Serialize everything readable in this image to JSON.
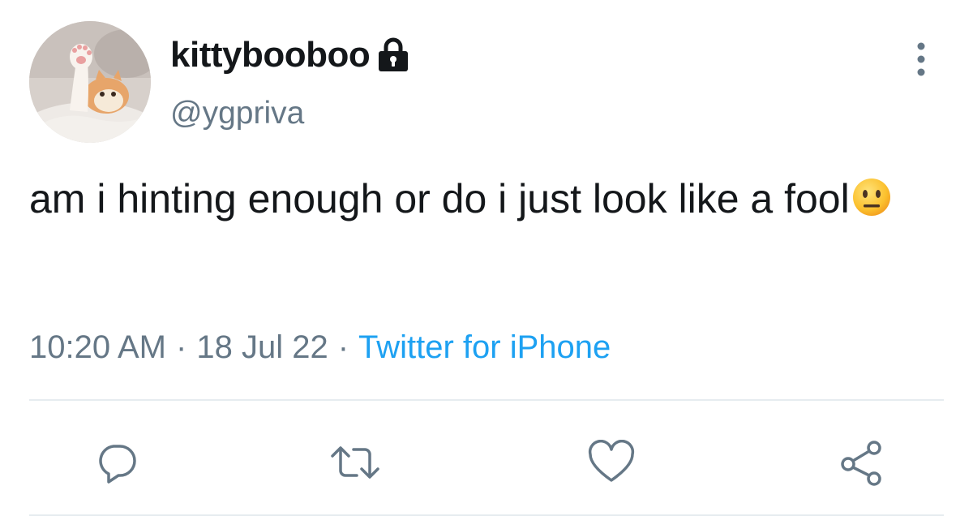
{
  "user": {
    "display_name": "kittybooboo",
    "handle": "@ygpriva",
    "protected_icon": "lock-icon",
    "avatar": "avatar-photo"
  },
  "tweet": {
    "text": "am i hinting enough or do i just look like a fool",
    "emoji": "neutral-face-emoji"
  },
  "meta": {
    "time": "10:20 AM",
    "separator": "·",
    "date": "18 Jul 22",
    "source": "Twitter for iPhone"
  },
  "menu": {
    "icon": "more-vertical-icon"
  },
  "actions": [
    {
      "icon": "reply-icon"
    },
    {
      "icon": "retweet-icon"
    },
    {
      "icon": "like-icon"
    },
    {
      "icon": "share-icon"
    }
  ],
  "colors": {
    "text": "#14171a",
    "secondary": "#657786",
    "link": "#1da1f2",
    "icon": "#657786",
    "divider": "#e6ecf0"
  }
}
